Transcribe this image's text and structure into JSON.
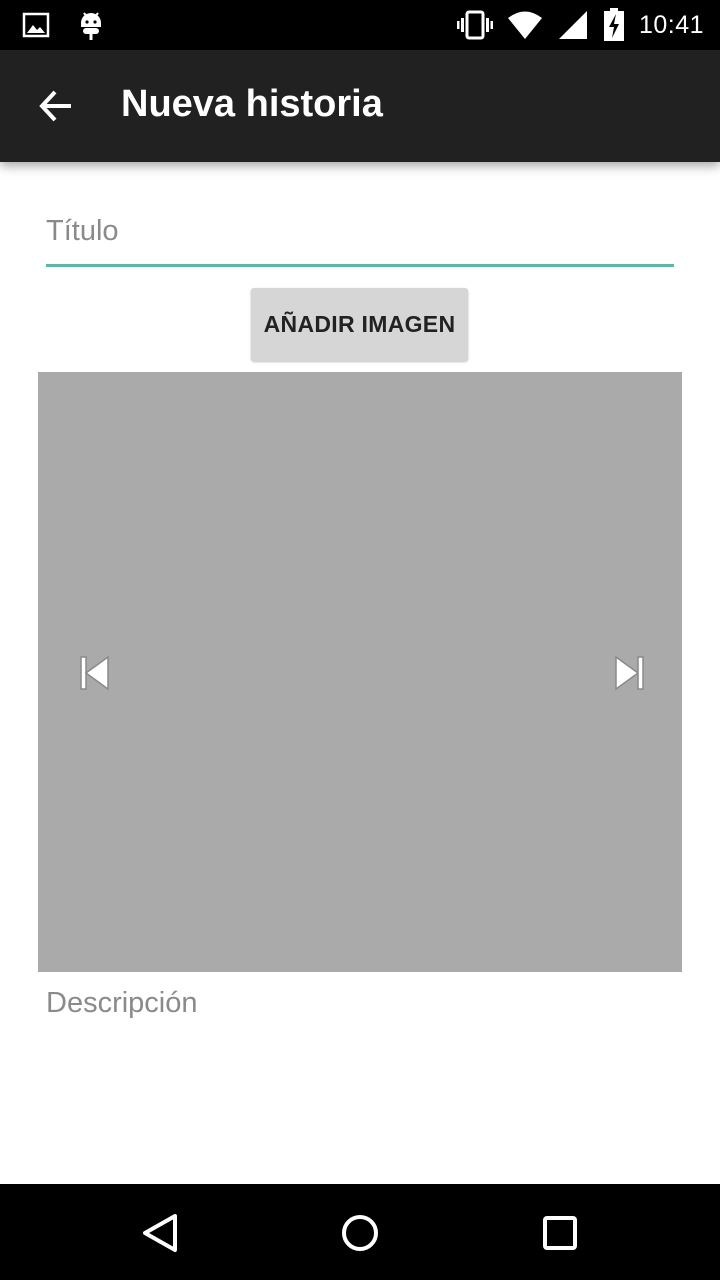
{
  "status_bar": {
    "time": "10:41",
    "icons": [
      "image-notification-icon",
      "android-debug-icon",
      "vibrate-icon",
      "wifi-icon",
      "signal-icon",
      "battery-charging-icon"
    ]
  },
  "app_bar": {
    "title": "Nueva historia",
    "back_icon": "arrow-back-icon"
  },
  "form": {
    "title_placeholder": "Título",
    "title_value": "",
    "add_image_label": "AÑADIR IMAGEN",
    "description_placeholder": "Descripción",
    "description_value": ""
  },
  "image_viewer": {
    "prev_icon": "skip-previous-icon",
    "next_icon": "skip-next-icon"
  },
  "nav_bar": {
    "icons": [
      "back-triangle-icon",
      "home-circle-icon",
      "recents-square-icon"
    ]
  },
  "colors": {
    "app_bar": "#212121",
    "accent_underline": "#5fb5a8",
    "image_placeholder": "#aaaaaa",
    "button_bg": "#d6d6d6"
  }
}
